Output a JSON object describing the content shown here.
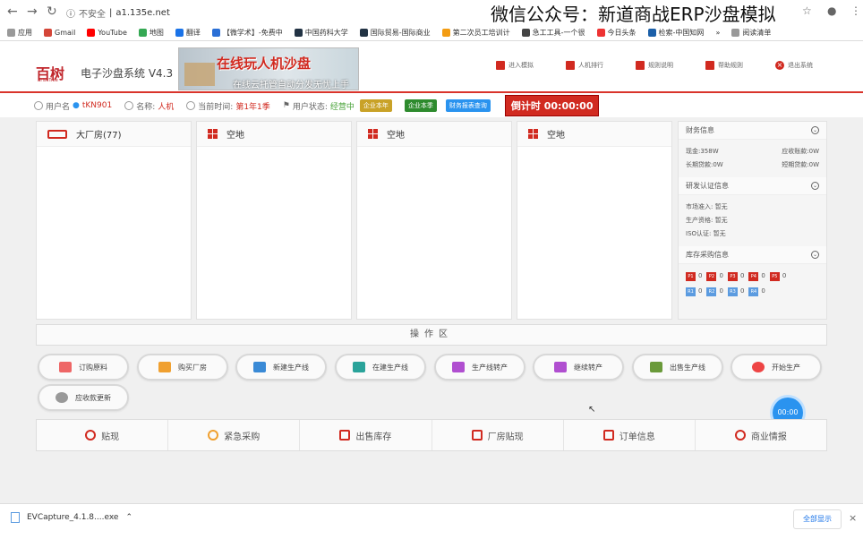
{
  "browser": {
    "url_warning": "不安全",
    "url": "a1.135e.net",
    "watermark": "微信公众号：新道商战ERP沙盘模拟",
    "bookmarks": [
      "应用",
      "Gmail",
      "YouTube",
      "地图",
      "翻译",
      "【微学术】-免费中",
      "中国药科大学",
      "国际贸易-国际商业",
      "第二次员工培训计",
      "急工工具-一个很",
      "今日头条",
      "检索-中国知网",
      "阅读清单"
    ]
  },
  "app": {
    "logo": "百树",
    "logo_sub": "BriskTree",
    "title": "电子沙盘系统 V4.3",
    "banner_title": "在线玩人机沙盘",
    "banner_sub": "在线云托管自动分发无忧上手",
    "top_menu": [
      "进入模拟",
      "人机排行",
      "规则说明",
      "帮助规则",
      "退出系统"
    ]
  },
  "status": {
    "username_label": "用户名",
    "username": "tKN901",
    "name_label": "名称:",
    "name": "人机",
    "time_label": "当前时间:",
    "time": "第1年1季",
    "state_label": "用户状态:",
    "state": "经营中",
    "btn1": "企业本年",
    "btn2": "企业本季",
    "btn3": "财务报表查询",
    "countdown": "倒计时 00:00:00"
  },
  "lands": [
    {
      "label": "大厂房(77)",
      "icon": "factory-icon"
    },
    {
      "label": "空地",
      "icon": "grid-icon"
    },
    {
      "label": "空地",
      "icon": "grid-icon"
    },
    {
      "label": "空地",
      "icon": "grid-icon"
    }
  ],
  "info": {
    "finance_title": "财务信息",
    "cash": "现金:358W",
    "receivable": "应收账款:0W",
    "long_loan": "长期贷款:0W",
    "short_loan": "短期贷款:0W",
    "cert_title": "研发认证信息",
    "market": "市场准入: 暂无",
    "product": "生产资格: 暂无",
    "iso": "ISO认证: 暂无",
    "stock_title": "库存采购信息",
    "products": [
      {
        "code": "P1",
        "qty": "0"
      },
      {
        "code": "P2",
        "qty": "0"
      },
      {
        "code": "P3",
        "qty": "0"
      },
      {
        "code": "P4",
        "qty": "0"
      },
      {
        "code": "P5",
        "qty": "0"
      }
    ],
    "materials": [
      {
        "code": "R1",
        "qty": "0"
      },
      {
        "code": "R2",
        "qty": "0"
      },
      {
        "code": "R3",
        "qty": "0"
      },
      {
        "code": "R4",
        "qty": "0"
      }
    ]
  },
  "op_area": "操作区",
  "ops": [
    "订购原料",
    "购买厂房",
    "新建生产线",
    "在建生产线",
    "生产线转产",
    "继续转产",
    "出售生产线",
    "开始生产",
    "应收款更新"
  ],
  "nav": [
    "贴现",
    "紧急采购",
    "出售库存",
    "厂房贴现",
    "订单信息",
    "商业情报"
  ],
  "timer": "00:00",
  "download": {
    "file": "EVCapture_4.1.8....exe",
    "show_all": "全部显示"
  }
}
